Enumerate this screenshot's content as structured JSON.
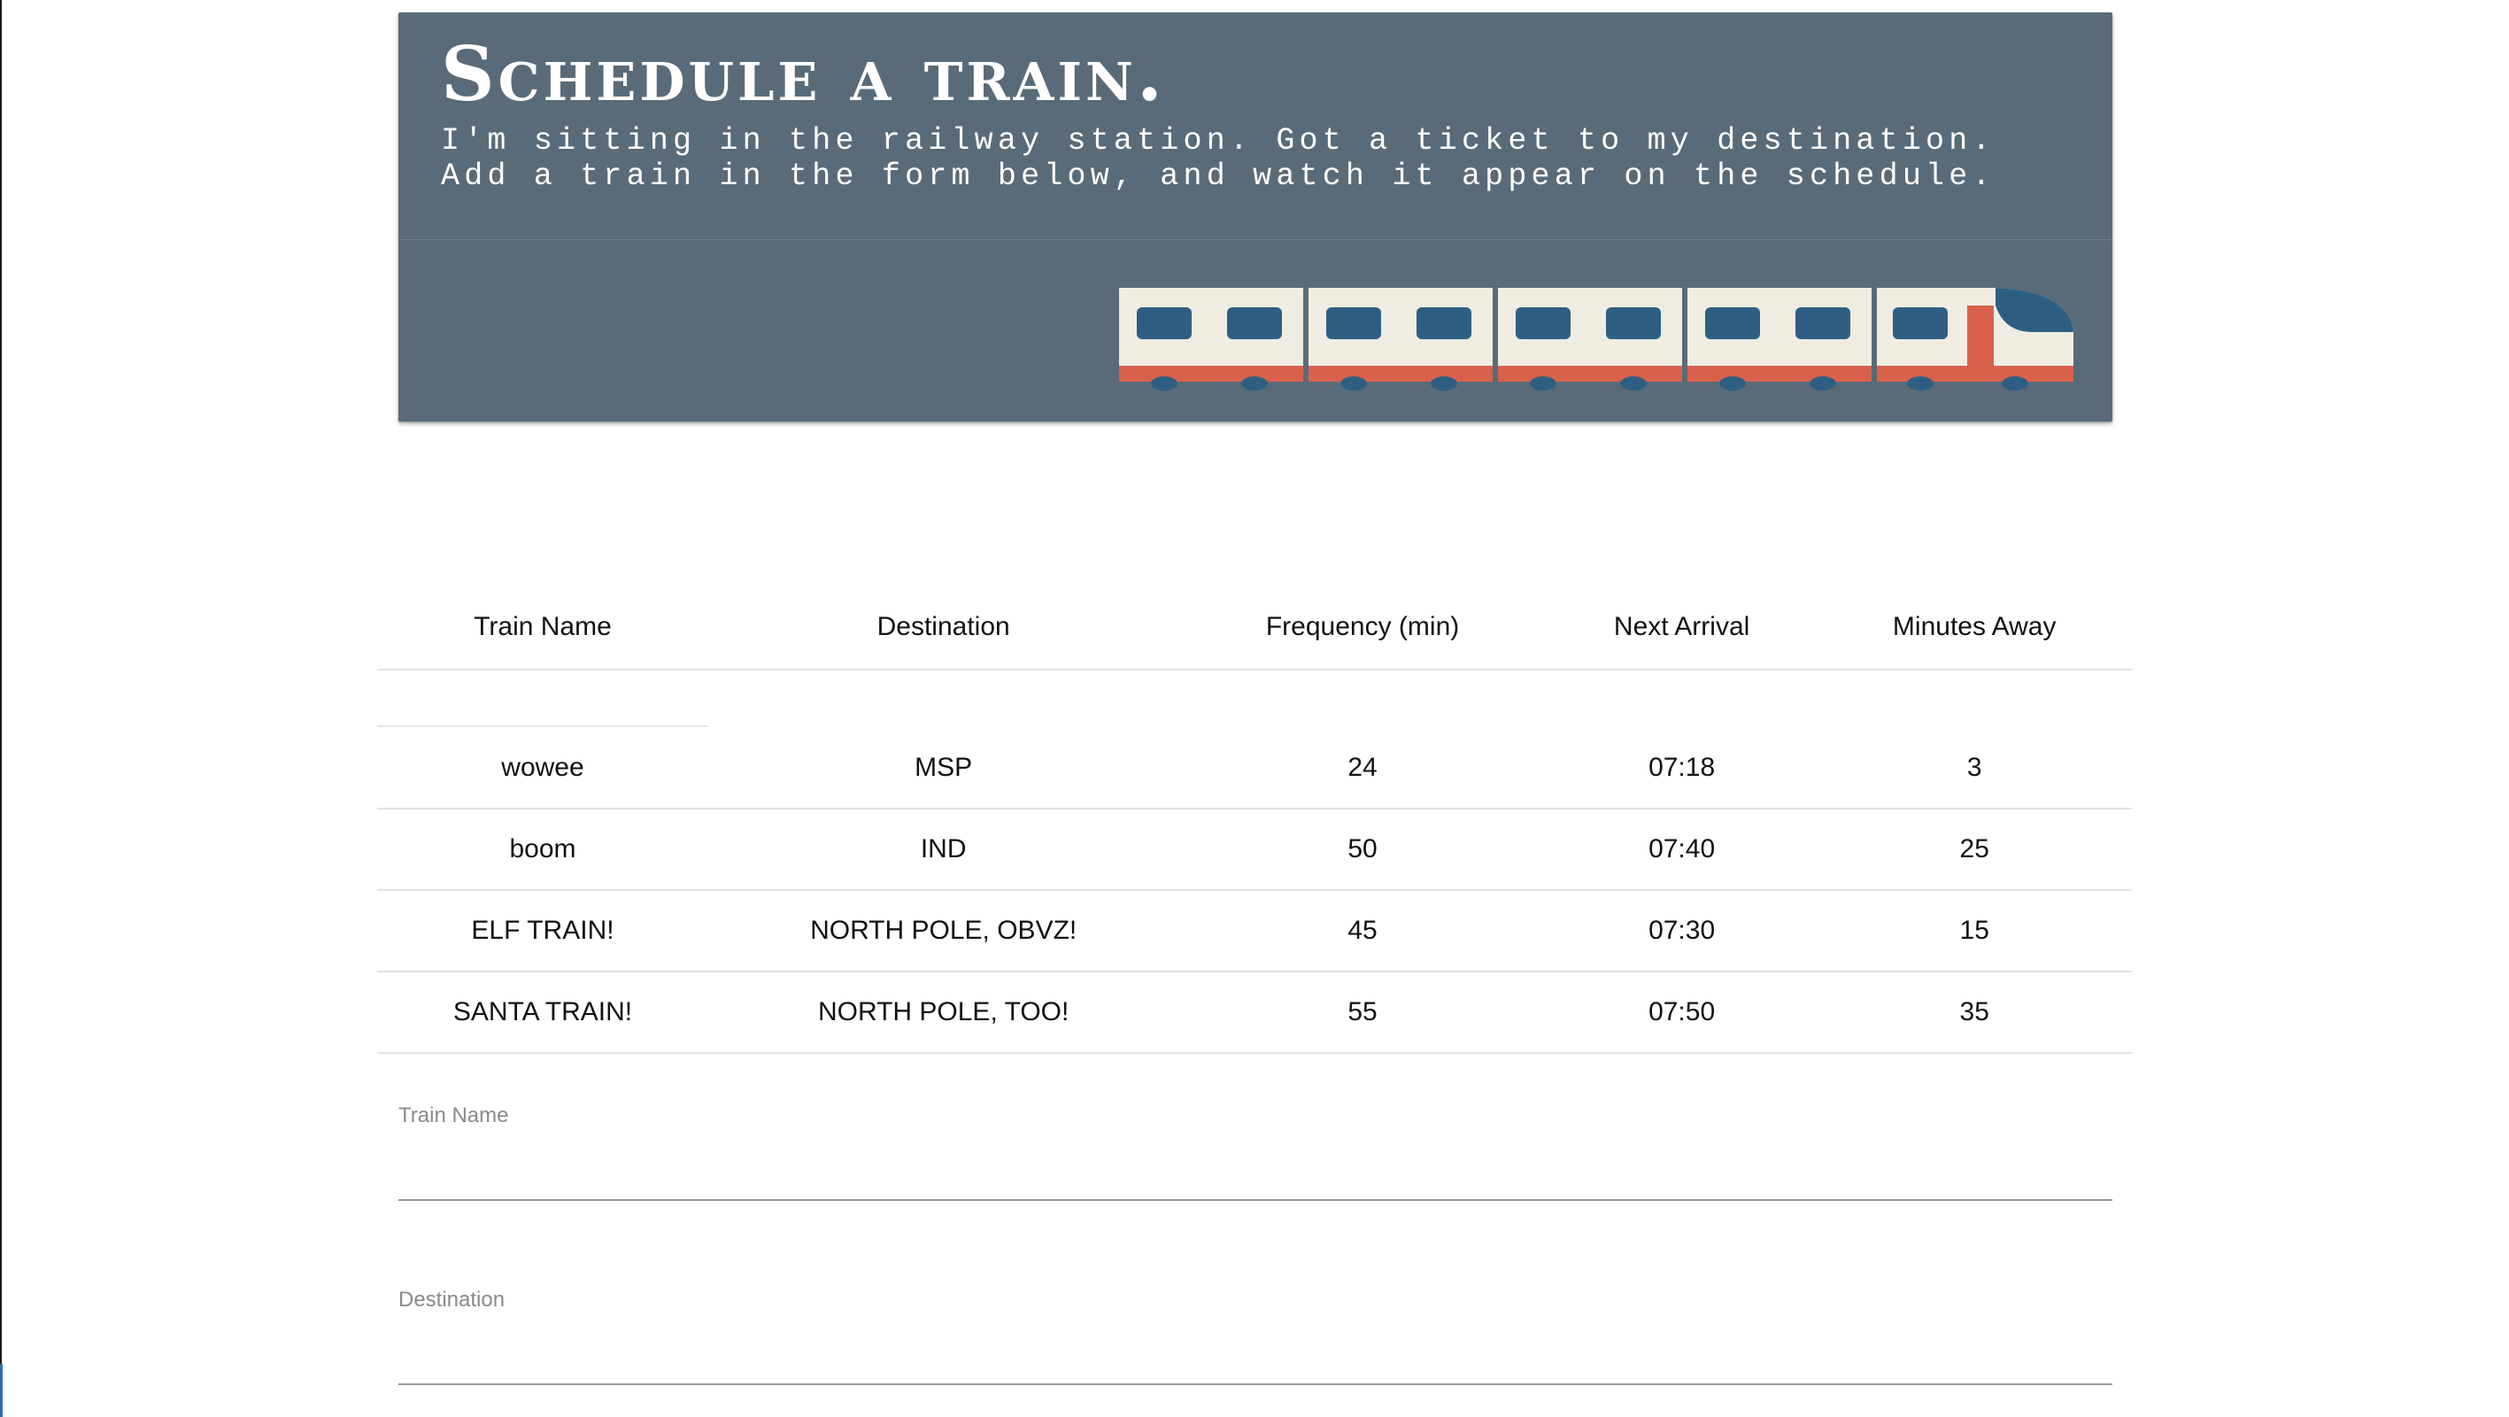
{
  "header": {
    "title": "Schedule a train.",
    "subtitle_line1": "I'm sitting in the railway station. Got a ticket to my destination.",
    "subtitle_line2": "Add a train in the form below, and watch it appear on the schedule.",
    "illustration_icon": "train-icon",
    "colors": {
      "card_bg": "#596b78",
      "train_body": "#efede2",
      "train_stripe": "#d9614c",
      "train_window": "#2e5f83"
    }
  },
  "schedule": {
    "columns": [
      "Train Name",
      "Destination",
      "Frequency (min)",
      "Next Arrival",
      "Minutes Away"
    ],
    "rows": [
      {
        "name": "wowee",
        "destination": "MSP",
        "frequency": "24",
        "next_arrival": "07:18",
        "minutes_away": "3"
      },
      {
        "name": "boom",
        "destination": "IND",
        "frequency": "50",
        "next_arrival": "07:40",
        "minutes_away": "25"
      },
      {
        "name": "ELF TRAIN!",
        "destination": "NORTH POLE, OBVZ!",
        "frequency": "45",
        "next_arrival": "07:30",
        "minutes_away": "15"
      },
      {
        "name": "SANTA TRAIN!",
        "destination": "NORTH POLE, TOO!",
        "frequency": "55",
        "next_arrival": "07:50",
        "minutes_away": "35"
      }
    ]
  },
  "form": {
    "train_name_label": "Train Name",
    "train_name_value": "",
    "destination_label": "Destination",
    "destination_value": ""
  }
}
